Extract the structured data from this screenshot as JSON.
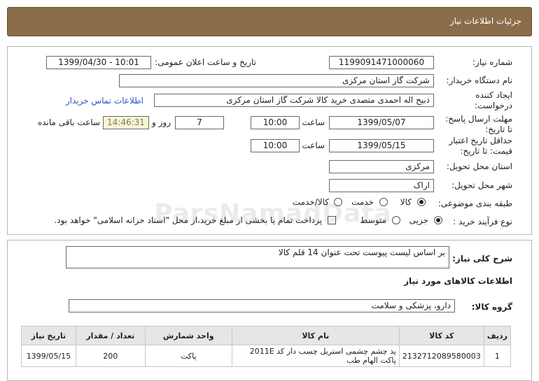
{
  "header": {
    "title": "جزئیات اطلاعات نیاز"
  },
  "form": {
    "need_number_label": "شماره نیاز:",
    "need_number": "1199091471000060",
    "announce_label": "تاریخ و ساعت اعلان عمومی:",
    "announce_value": "1399/04/30 - 10:01",
    "buyer_label": "نام دستگاه خریدار:",
    "buyer": "شرکت گاز استان مرکزی",
    "creator_label_line1": "ایجاد کننده",
    "creator_label_line2": "درخواست:",
    "creator": "ذبیح اله احمدی متصدی خرید کالا شرکت گاز استان مرکزی",
    "contact_link": "اطلاعات تماس خریدار",
    "deadline_label_line1": "مهلت ارسال پاسخ:",
    "deadline_label_line2": "تا تاریخ:",
    "deadline_date": "1399/05/07",
    "time_label": "ساعت",
    "deadline_time": "10:00",
    "days_value": "7",
    "days_label": "روز و",
    "remaining_time": "14:46:31",
    "remaining_label": "ساعت باقی مانده",
    "validity_label_line1": "حداقل تاریخ اعتبار",
    "validity_label_line2": "قیمت: تا تاریخ:",
    "validity_date": "1399/05/15",
    "validity_time_label": "ساعت",
    "validity_time": "10:00",
    "province_label": "استان محل تحویل:",
    "province": "مرکزی",
    "city_label": "شهر محل تحویل:",
    "city": "اراک",
    "category_label": "طبقه بندی موضوعی:",
    "category_options": [
      "کالا",
      "خدمت",
      "کالا/خدمت"
    ],
    "category_selected": "کالا",
    "process_label": "نوع فرآیند خرید :",
    "process_options": [
      "جزیی",
      "متوسط"
    ],
    "process_selected": "جزیی",
    "treasury_text": "پرداخت تمام یا بخشی از مبلغ خرید،از محل \"اسناد خزانه اسلامی\" خواهد بود."
  },
  "summary": {
    "label": "شرح کلی نیاز:",
    "text": "بر اساس لیست پیوست تحت عنوان 14 قلم کالا"
  },
  "goods": {
    "section_title": "اطلاعات کالاهای مورد نیاز",
    "group_label": "گروه کالا:",
    "group_value": "دارو، پزشکی و سلامت",
    "columns": [
      "ردیف",
      "کد کالا",
      "نام کالا",
      "واحد شمارش",
      "تعداد / مقدار",
      "تاریخ نیاز"
    ],
    "rows": [
      {
        "row": "1",
        "code": "2132712089580003",
        "name": "پد چشم چشمی استریل چسب دار کد 2011E پاکت الهام طب",
        "unit": "پاکت",
        "qty": "200",
        "date": "1399/05/15"
      }
    ]
  },
  "watermark": {
    "text": "ParsNamadData"
  }
}
